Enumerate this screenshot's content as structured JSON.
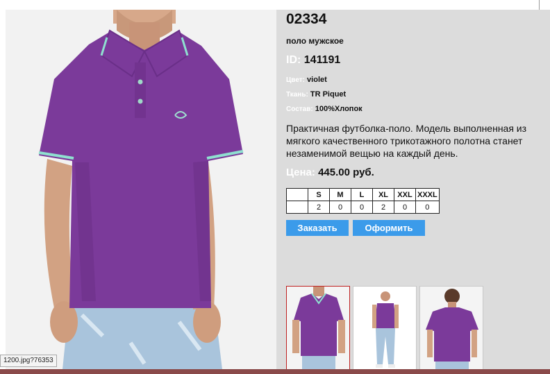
{
  "product": {
    "sku": "02334",
    "subtitle": "поло мужское",
    "id_label": "ID:",
    "id_value": "141191",
    "attributes": [
      {
        "label": "Цвет:",
        "value": "violet"
      },
      {
        "label": "Ткань:",
        "value": "TR Piquet"
      },
      {
        "label": "Состав:",
        "value": "100%Хлопок"
      }
    ],
    "description": "Практичная футболка-поло. Модель выполненная из мягкого качественного трикотажного полотна станет незаменимой вещью на каждый день.",
    "price_label": "Цена:",
    "price_value": "445.00 руб."
  },
  "sizes": {
    "headers": [
      "",
      "S",
      "M",
      "L",
      "XL",
      "XXL",
      "XXXL"
    ],
    "values": [
      "",
      "2",
      "0",
      "0",
      "2",
      "0",
      "0"
    ]
  },
  "buttons": {
    "order": "Заказать",
    "checkout": "Оформить"
  },
  "status_tip": "1200.jpg?76353",
  "colors": {
    "panel_bg": "#dcdcdc",
    "button": "#3b9bea",
    "shirt": "#7b3a9a",
    "active_thumb_border": "#c02020"
  },
  "thumbnails": [
    {
      "name": "polo-front-closeup",
      "active": true
    },
    {
      "name": "full-body-front",
      "active": false
    },
    {
      "name": "polo-back",
      "active": false
    }
  ]
}
